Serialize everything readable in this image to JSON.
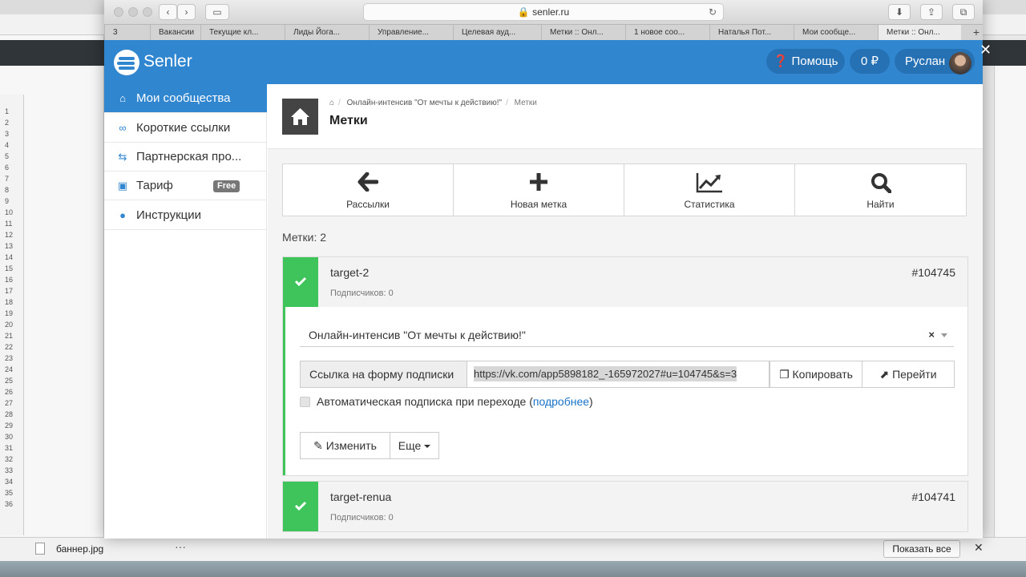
{
  "browser": {
    "url": "senler.ru",
    "tabs": [
      "3",
      "Вакансии",
      "Текущие кл...",
      "Лиды Йога...",
      "Управление...",
      "Целевая ауд...",
      "Метки :: Онл...",
      "1 новое соо...",
      "Наталья Пот...",
      "Мои сообще...",
      "Метки :: Онл..."
    ],
    "active_tab": 10,
    "new_tab": "+"
  },
  "background": {
    "download_file": "баннер.jpg",
    "download_more": "···",
    "show_all": "Показать все",
    "close": "✕",
    "sheet_rows": [
      "",
      "1",
      "2",
      "3",
      "4",
      "5",
      "6",
      "7",
      "8",
      "9",
      "10",
      "11",
      "12",
      "13",
      "14",
      "15",
      "16",
      "17",
      "18",
      "19",
      "20",
      "21",
      "22",
      "23",
      "24",
      "25",
      "26",
      "27",
      "28",
      "29",
      "30",
      "31",
      "32",
      "33",
      "34",
      "35",
      "36"
    ]
  },
  "header": {
    "logo": "Senler",
    "help": "Помощь",
    "balance": "0 ₽",
    "user": "Руслан",
    "close": "✕"
  },
  "sidebar": {
    "items": [
      {
        "label": "Мои сообщества",
        "icon": "home-icon"
      },
      {
        "label": "Короткие ссылки",
        "icon": "link-icon"
      },
      {
        "label": "Партнерская про...",
        "icon": "handshake-icon"
      },
      {
        "label": "Тариф",
        "icon": "money-icon",
        "badge": "Free"
      },
      {
        "label": "Инструкции",
        "icon": "info-icon"
      }
    ]
  },
  "page": {
    "breadcrumb": [
      "Онлайн-интенсив \"От мечты к действию!\"",
      "Метки"
    ],
    "title": "Метки",
    "toolbar": [
      "Рассылки",
      "Новая метка",
      "Статистика",
      "Найти"
    ],
    "count": "Метки: 2"
  },
  "tags": [
    {
      "name": "target-2",
      "subscribers": "Подписчиков: 0",
      "id": "#104745",
      "group": "Онлайн-интенсив \"От мечты к действию!\"",
      "link_label": "Ссылка на форму подписки",
      "link": "https://vk.com/app5898182_-165972027#u=104745&s=3",
      "copy": "Копировать",
      "go": "Перейти",
      "auto_text": "Автоматическая подписка при переходе (",
      "auto_link": "подробнее",
      "auto_end": ")",
      "edit": "Изменить",
      "more": "Еще"
    },
    {
      "name": "target-renua",
      "subscribers": "Подписчиков: 0",
      "id": "#104741"
    }
  ],
  "colors": {
    "brand": "#3186d0",
    "success": "#3ec45a"
  }
}
